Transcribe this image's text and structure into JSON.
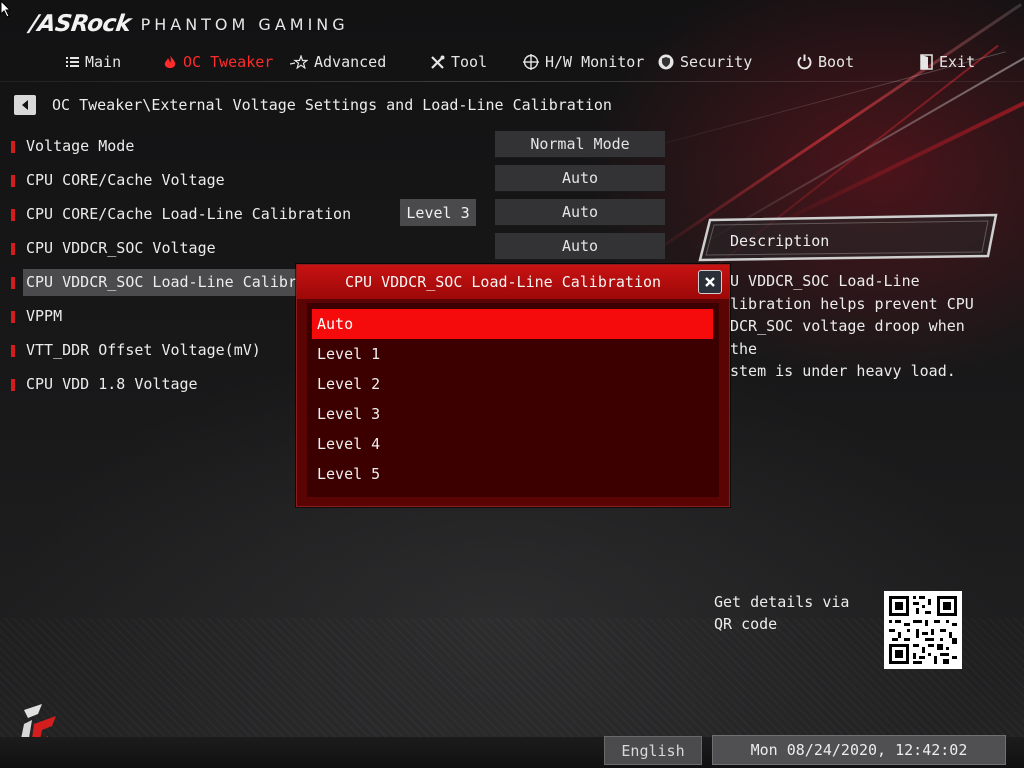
{
  "brand": {
    "logo": "/ASRock",
    "subtitle": "PHANTOM GAMING"
  },
  "nav": {
    "items": [
      {
        "label": "Main",
        "icon": "list-icon",
        "active": false
      },
      {
        "label": "OC Tweaker",
        "icon": "flame-icon",
        "active": true
      },
      {
        "label": "Advanced",
        "icon": "star-icon",
        "active": false
      },
      {
        "label": "Tool",
        "icon": "tools-icon",
        "active": false
      },
      {
        "label": "H/W Monitor",
        "icon": "crosshair-icon",
        "active": false
      },
      {
        "label": "Security",
        "icon": "shield-icon",
        "active": false
      },
      {
        "label": "Boot",
        "icon": "power-icon",
        "active": false
      },
      {
        "label": "Exit",
        "icon": "exit-door-icon",
        "active": false
      }
    ]
  },
  "breadcrumb": "OC Tweaker\\External Voltage Settings and Load-Line Calibration",
  "settings": [
    {
      "label": "Voltage Mode",
      "value": "Normal Mode"
    },
    {
      "label": "CPU CORE/Cache Voltage",
      "value": "Auto"
    },
    {
      "label": "CPU CORE/Cache Load-Line Calibration",
      "current": "Level 3",
      "value": "Auto"
    },
    {
      "label": "CPU VDDCR_SOC Voltage",
      "value": "Auto"
    },
    {
      "label": "CPU VDDCR_SOC Load-Line Calibration",
      "value": ""
    },
    {
      "label": "VPPM",
      "value": ""
    },
    {
      "label": "VTT_DDR Offset Voltage(mV)",
      "value": ""
    },
    {
      "label": "CPU VDD 1.8 Voltage",
      "value": ""
    }
  ],
  "description": {
    "title": "Description",
    "lines": [
      "U VDDCR_SOC Load-Line",
      "libration helps prevent CPU",
      "DCR_SOC voltage droop when the",
      "stem is under heavy load."
    ]
  },
  "qr": {
    "label": "Get details via QR code"
  },
  "modal": {
    "title": "CPU VDDCR_SOC Load-Line Calibration",
    "options": [
      "Auto",
      "Level 1",
      "Level 2",
      "Level 3",
      "Level 4",
      "Level 5"
    ],
    "selected": "Auto"
  },
  "footer": {
    "language": "English",
    "datetime": "Mon 08/24/2020, 12:42:02"
  },
  "colors": {
    "accent": "#ff2a2a",
    "modal_bg": "#5a0404",
    "modal_title": "#c81212",
    "selected_option": "#f50b0b"
  }
}
